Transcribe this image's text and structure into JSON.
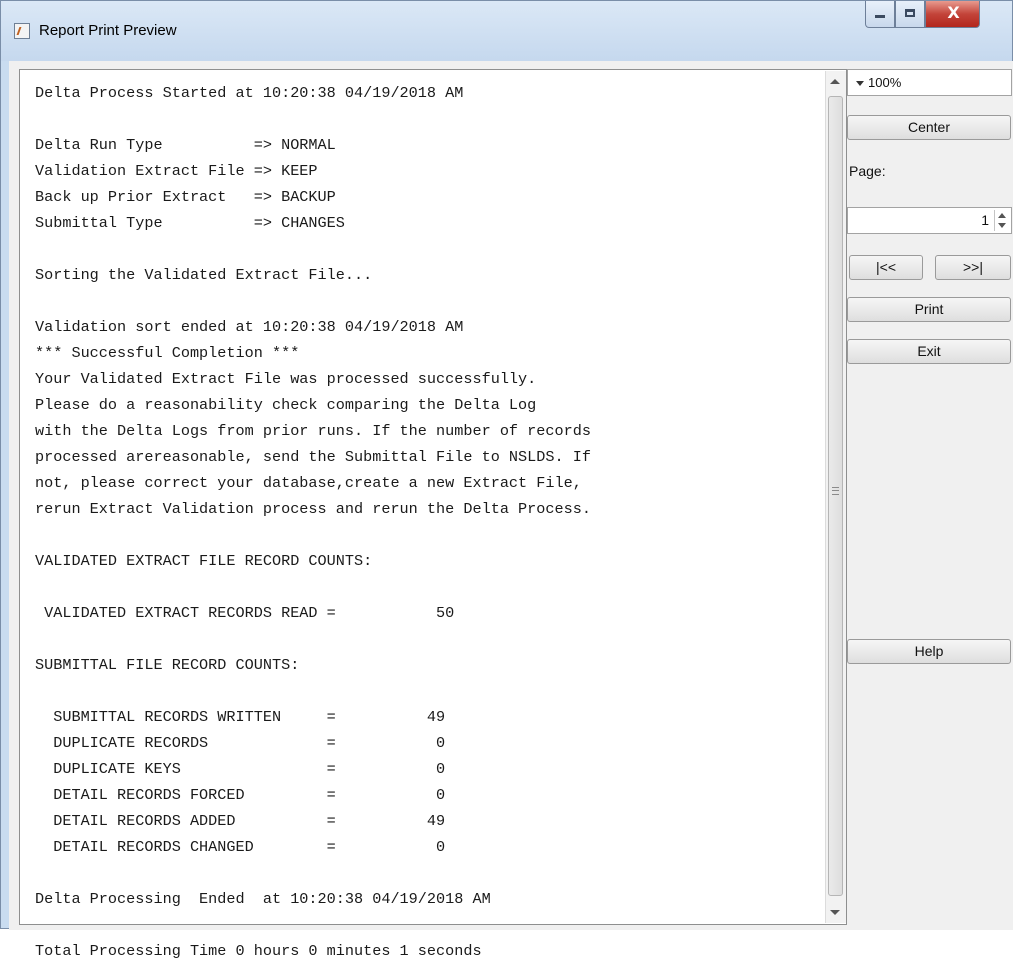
{
  "window": {
    "title": "Report Print Preview",
    "close_glyph": "X"
  },
  "report": {
    "lines": [
      "Delta Process Started at 10:20:38 04/19/2018 AM",
      "",
      "Delta Run Type          => NORMAL",
      "Validation Extract File => KEEP",
      "Back up Prior Extract   => BACKUP",
      "Submittal Type          => CHANGES",
      "",
      "Sorting the Validated Extract File...",
      "",
      "Validation sort ended at 10:20:38 04/19/2018 AM",
      "*** Successful Completion ***",
      "Your Validated Extract File was processed successfully.",
      "Please do a reasonability check comparing the Delta Log",
      "with the Delta Logs from prior runs. If the number of records",
      "processed arereasonable, send the Submittal File to NSLDS. If",
      "not, please correct your database,create a new Extract File,",
      "rerun Extract Validation process and rerun the Delta Process.",
      "",
      "VALIDATED EXTRACT FILE RECORD COUNTS:",
      "",
      " VALIDATED EXTRACT RECORDS READ =           50",
      "",
      "SUBMITTAL FILE RECORD COUNTS:",
      "",
      "  SUBMITTAL RECORDS WRITTEN     =          49",
      "  DUPLICATE RECORDS             =           0",
      "  DUPLICATE KEYS                =           0",
      "  DETAIL RECORDS FORCED         =           0",
      "  DETAIL RECORDS ADDED          =          49",
      "  DETAIL RECORDS CHANGED        =           0",
      "",
      "Delta Processing  Ended  at 10:20:38 04/19/2018 AM",
      "",
      "Total Processing Time 0 hours 0 minutes 1 seconds"
    ]
  },
  "side_panel": {
    "zoom": "100%",
    "center_label": "Center",
    "page_label": "Page:",
    "page_value": "1",
    "first_label": "|<<",
    "last_label": ">>|",
    "print_label": "Print",
    "exit_label": "Exit",
    "help_label": "Help"
  }
}
